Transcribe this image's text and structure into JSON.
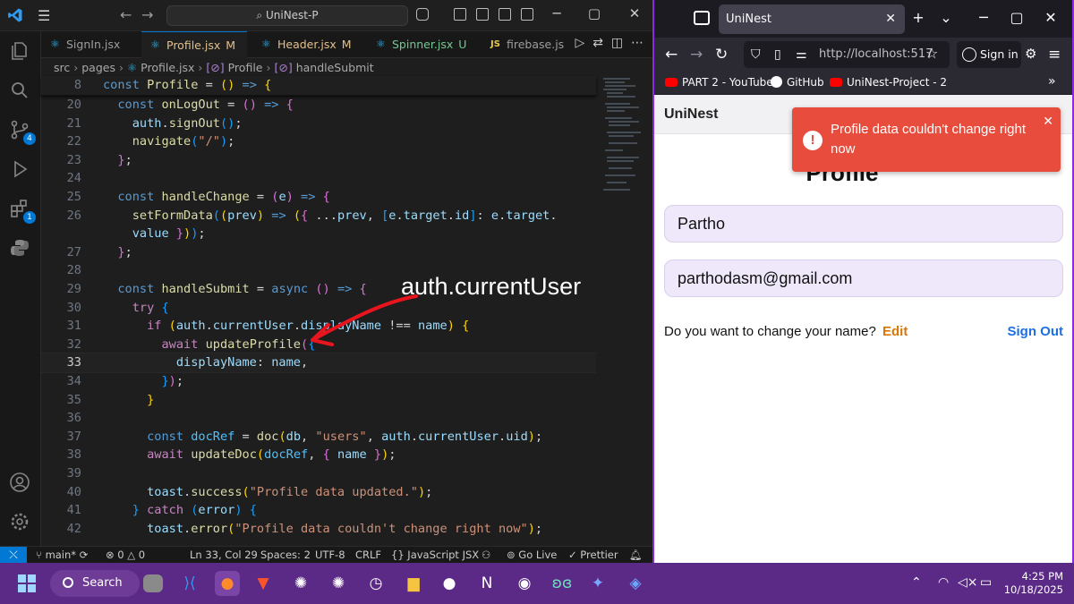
{
  "vscode": {
    "search_text": "UniNest-P",
    "tabs": [
      {
        "name": "SignIn.jsx",
        "status": ""
      },
      {
        "name": "Profile.jsx",
        "status": "M"
      },
      {
        "name": "Header.jsx",
        "status": "M"
      },
      {
        "name": "Spinner.jsx",
        "status": "U"
      },
      {
        "name": "firebase.js",
        "status": ""
      }
    ],
    "breadcrumb": [
      "src",
      "pages",
      "Profile.jsx",
      "Profile",
      "handleSubmit"
    ],
    "sticky_line_number": "8",
    "badges": {
      "source_control": "4",
      "extensions": "1"
    },
    "annotation": "auth.currentUser",
    "line_numbers": [
      "20",
      "21",
      "22",
      "23",
      "24",
      "25",
      "26",
      "",
      "27",
      "28",
      "29",
      "30",
      "31",
      "32",
      "33",
      "34",
      "35",
      "36",
      "37",
      "38",
      "39",
      "40",
      "41",
      "42"
    ],
    "status": {
      "branch": "main*",
      "errors": "0",
      "warnings": "0",
      "cursor": "Ln 33, Col 29",
      "spaces": "Spaces: 2",
      "encoding": "UTF-8",
      "eol": "CRLF",
      "language": "JavaScript JSX",
      "golive": "Go Live",
      "prettier": "Prettier"
    }
  },
  "firefox": {
    "tab_title": "UniNest",
    "url": "http://localhost:517",
    "signin_label": "Sign in",
    "bookmarks": [
      "PART 2 - YouTube",
      "GitHub",
      "UniNest-Project - 2"
    ],
    "app": {
      "brand": "UniNest",
      "title": "Profile",
      "name_value": "Partho",
      "email_value": "parthodasm@gmail.com",
      "edit_prompt": "Do you want to change your name?",
      "edit_label": "Edit",
      "signout_label": "Sign Out",
      "toast_message": "Profile data couldn't change right now",
      "toast_color": "#e74c3c"
    }
  },
  "taskbar": {
    "search_label": "Search",
    "time": "4:25 PM",
    "date": "10/18/2025"
  }
}
